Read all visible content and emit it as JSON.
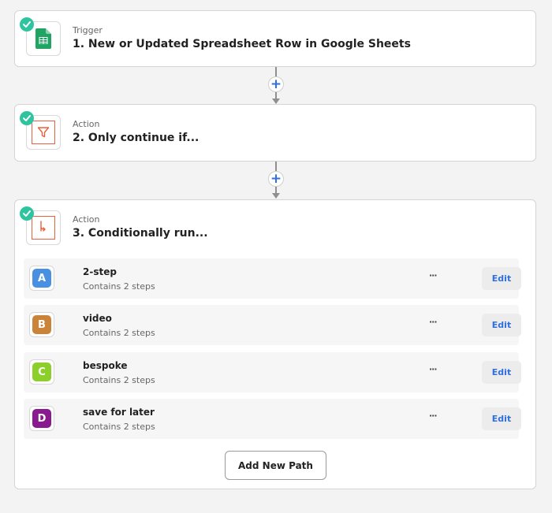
{
  "steps": [
    {
      "kind": "Trigger",
      "title": "1. New or Updated Spreadsheet Row in Google Sheets",
      "icon": "google-sheets-icon"
    },
    {
      "kind": "Action",
      "title": "2. Only continue if...",
      "icon": "filter-icon"
    },
    {
      "kind": "Action",
      "title": "3. Conditionally run...",
      "icon": "paths-icon"
    }
  ],
  "connectors": {
    "plus_label": "+"
  },
  "paths": [
    {
      "letter": "A",
      "name": "2-step",
      "subtitle": "Contains 2 steps",
      "color": "#4a90e2",
      "more": "···",
      "edit": "Edit"
    },
    {
      "letter": "B",
      "name": "video",
      "subtitle": "Contains 2 steps",
      "color": "#c9843a",
      "more": "···",
      "edit": "Edit"
    },
    {
      "letter": "C",
      "name": "bespoke",
      "subtitle": "Contains 2 steps",
      "color": "#8ccf2a",
      "more": "···",
      "edit": "Edit"
    },
    {
      "letter": "D",
      "name": "save for later",
      "subtitle": "Contains 2 steps",
      "color": "#8a1a8f",
      "more": "···",
      "edit": "Edit"
    }
  ],
  "add_path_label": "Add New Path",
  "colors": {
    "accent": "#2f6fe0",
    "check": "#2ec4a0",
    "filter": "#e8603c"
  }
}
